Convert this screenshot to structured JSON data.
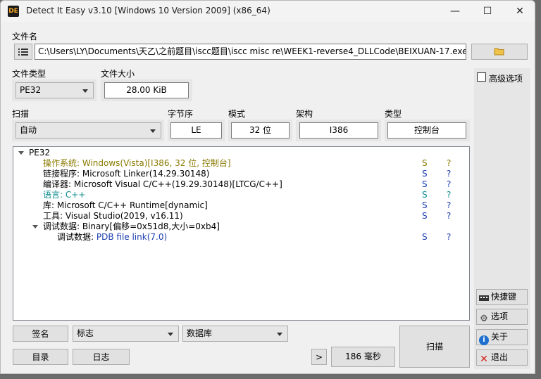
{
  "window": {
    "title": "Detect It Easy v3.10 [Windows 10 Version 2009] (x86_64)",
    "icon_text": "DE",
    "minimize": "—",
    "maximize": "☐",
    "close": "✕"
  },
  "file": {
    "label": "文件名",
    "path": "C:\\Users\\LY\\Documents\\天乙\\之前题目\\iscc题目\\iscc misc re\\WEEK1-reverse4_DLLCode\\BEIXUAN-17.exe",
    "menu_icon": "list-icon",
    "open_icon": "folder-icon"
  },
  "filetype": {
    "label": "文件类型",
    "value": "PE32"
  },
  "filesize": {
    "label": "文件大小",
    "value": "28.00 KiB"
  },
  "advanced": {
    "label": "高级选项",
    "checked": false
  },
  "scan": {
    "label": "扫描",
    "value": "自动"
  },
  "endian": {
    "label": "字节序",
    "value": "LE"
  },
  "mode": {
    "label": "模式",
    "value": "32 位"
  },
  "arch": {
    "label": "架构",
    "value": "I386"
  },
  "type": {
    "label": "类型",
    "value": "控制台"
  },
  "results": {
    "root": "PE32",
    "rows": [
      {
        "key": "操作系统: ",
        "val": "Windows(Vista)[I386, 32 位, 控制台]",
        "s": "S",
        "q": "?",
        "color": "#8a7a00"
      },
      {
        "key": "链接程序: ",
        "val": "Microsoft Linker(14.29.30148)",
        "s": "S",
        "q": "?",
        "color": "#000000"
      },
      {
        "key": "编译器: ",
        "val": "Microsoft Visual C/C++(19.29.30148)[LTCG/C++]",
        "s": "S",
        "q": "?",
        "color": "#000000"
      },
      {
        "key": "语言: ",
        "val": "C++",
        "s": "S",
        "q": "?",
        "color": "#0a8a8a"
      },
      {
        "key": "库: ",
        "val": "Microsoft C/C++ Runtime[dynamic]",
        "s": "S",
        "q": "?",
        "color": "#000000"
      },
      {
        "key": "工具: ",
        "val": "Visual Studio(2019, v16.11)",
        "s": "S",
        "q": "?",
        "color": "#000000"
      },
      {
        "key": "调试数据: ",
        "val": "Binary[偏移=0x51d8,大小=0xb4]",
        "s": "",
        "q": "",
        "color": "#000000"
      },
      {
        "key": "调试数据: ",
        "val": "PDB file link(7.0)",
        "s": "S",
        "q": "?",
        "color": "#1a3cb0"
      }
    ]
  },
  "side": {
    "shortcuts": "快捷键",
    "options": "选项",
    "about": "关于",
    "exit": "退出"
  },
  "bottom": {
    "signature": "签名",
    "flags": "标志",
    "database": "数据库",
    "directory": "目录",
    "log": "日志",
    "more": ">",
    "time": "186 毫秒",
    "scan_button": "扫描"
  }
}
